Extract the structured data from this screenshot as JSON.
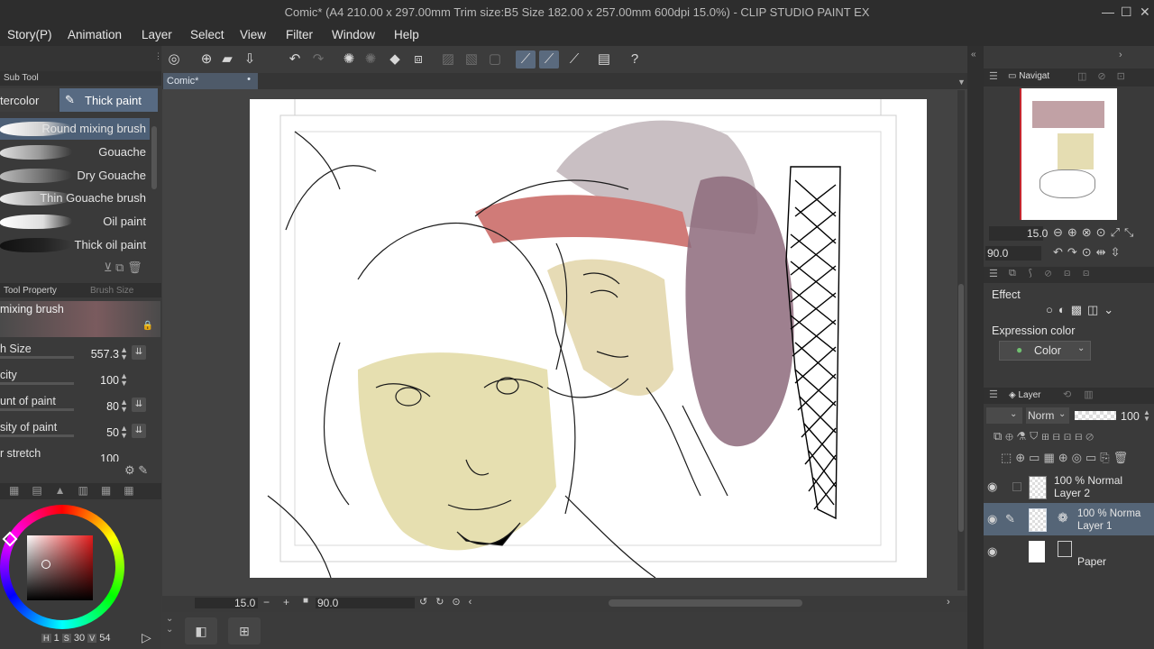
{
  "window": {
    "title": "Comic* (A4 210.00 x 297.00mm Trim size:B5 Size 182.00 x 257.00mm 600dpi 15.0%)  - CLIP STUDIO PAINT EX",
    "min": "—",
    "max": "☐",
    "close": "✕"
  },
  "menu": [
    "Story(P)",
    "Animation",
    "Layer",
    "Select",
    "View",
    "Filter",
    "Window",
    "Help"
  ],
  "subtool": {
    "header": "Sub Tool",
    "tab_watercolor": "tercolor",
    "tab_thick": "Thick paint",
    "brushes": [
      "Round mixing brush",
      "Gouache",
      "Dry Gouache",
      "Thin Gouache brush",
      "Oil paint",
      "Thick oil paint"
    ]
  },
  "tool_property": {
    "header": "Tool Property",
    "header2": "Brush Size",
    "name": "mixing brush",
    "rows": [
      {
        "label": "h Size",
        "value": "557.3"
      },
      {
        "label": "city",
        "value": "100"
      },
      {
        "label": "unt of paint",
        "value": "80"
      },
      {
        "label": "sity of paint",
        "value": "50"
      },
      {
        "label": "r stretch",
        "value": "100"
      }
    ]
  },
  "color": {
    "h": "1",
    "s": "30",
    "v": "54",
    "h_label": "H",
    "s_label": "S",
    "v_label": "V",
    "accent": "#c2262e"
  },
  "doc_tab": {
    "label": "Comic*",
    "dot": "•"
  },
  "status": {
    "zoom": "15.0",
    "angle": "90.0"
  },
  "navigator": {
    "tab": "Navigat",
    "zoom": "15.0",
    "angle": "90.0"
  },
  "effect": {
    "label": "Effect",
    "expression_label": "Expression color",
    "expression_value": "Color"
  },
  "layer_panel": {
    "tab": "Layer",
    "blend": "Norm",
    "opacity": "100",
    "layers": [
      {
        "line1": "100 % Normal",
        "line2": "Layer 2"
      },
      {
        "line1": "100 % Norma",
        "line2": "Layer 1"
      },
      {
        "line1": "",
        "line2": "Paper"
      }
    ]
  }
}
